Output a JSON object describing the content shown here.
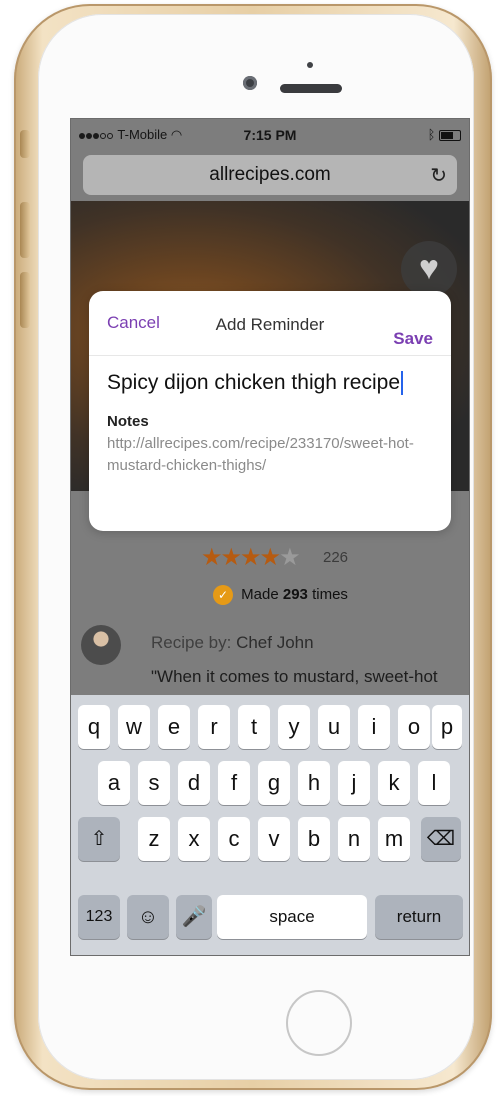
{
  "status_bar": {
    "carrier": "T-Mobile",
    "time": "7:15 PM"
  },
  "browser": {
    "url": "allrecipes.com",
    "reload_icon": "reload-icon"
  },
  "dialog": {
    "cancel_label": "Cancel",
    "title": "Add Reminder",
    "save_label": "Save",
    "reminder_text": "Spicy dijon chicken thigh recipe",
    "notes_label": "Notes",
    "notes_url": "http://allrecipes.com/recipe/233170/sweet-hot-mustard-chicken-thighs/"
  },
  "recipe": {
    "rating_count": "226",
    "made_prefix": "Made",
    "made_count": "293",
    "made_suffix": "times",
    "recipe_by_label": "Recipe by:",
    "author": "Chef John",
    "quote": "\"When it comes to mustard, sweet-hot"
  },
  "keyboard": {
    "row1": [
      "q",
      "w",
      "e",
      "r",
      "t",
      "y",
      "u",
      "i",
      "o",
      "p"
    ],
    "row2": [
      "a",
      "s",
      "d",
      "f",
      "g",
      "h",
      "j",
      "k",
      "l"
    ],
    "row3": [
      "z",
      "x",
      "c",
      "v",
      "b",
      "n",
      "m"
    ],
    "numbers_key": "123",
    "space_key": "space",
    "return_key": "return"
  }
}
